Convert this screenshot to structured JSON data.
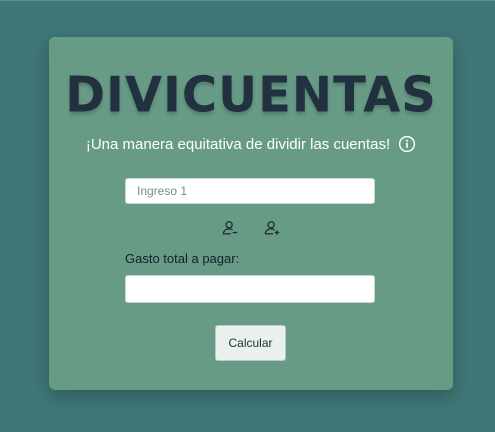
{
  "app": {
    "title": "DIVICUENTAS",
    "subtitle": "¡Una manera equitativa de dividir las cuentas!"
  },
  "form": {
    "ingreso_placeholder": "Ingreso 1",
    "gasto_label": "Gasto total a pagar:",
    "gasto_value": "",
    "calcular_label": "Calcular"
  },
  "icons": {
    "info": "info-circle-icon",
    "remove_person": "person-remove-icon",
    "add_person": "person-add-icon"
  },
  "colors": {
    "background": "#3e7776",
    "card": "#679b86",
    "title": "#22313f"
  }
}
